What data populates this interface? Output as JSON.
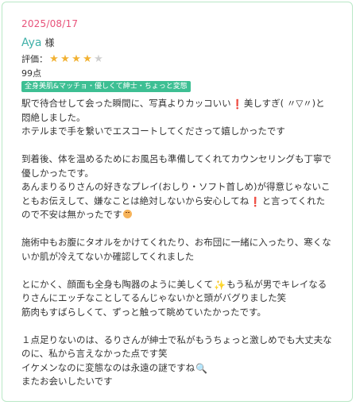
{
  "review": {
    "date": "2025/08/17",
    "reviewer_name": "Aya",
    "honorific": "様",
    "rating_label": "評価：",
    "rating": 4,
    "rating_max": 5,
    "score": "99点",
    "tag": "全身美肌&マッチョ・優しくて紳士・ちょっと変態"
  },
  "body": {
    "l01": "駅で待合せして会った瞬間に、写真よりカッコいい",
    "l01b": "美しすぎ( 〃▽〃)と",
    "l02": "悶絶しました。",
    "l03": "ホテルまで手を繋いでエスコートしてくださって嬉しかったです",
    "l04": "到着後、体を温めるためにお風呂も準備してくれてカウンセリングも丁寧で",
    "l05": "優しかったです。",
    "l06": "あんまりるりさんの好きなプレイ(おしり・ソフト首しめ)が得意じゃないこ",
    "l07": "ともお伝えして、嫌なことは絶対しないから安心してね",
    "l07b": "と言ってくれた",
    "l08": "ので不安は無かったです",
    "l09": "施術中もお腹にタオルをかけてくれたり、お布団に一緒に入ったり、寒くな",
    "l10": "いか肌が冷えてないか確認してくれました",
    "l11": "とにかく、顔面も全身も陶器のように美しくて",
    "l11b": "もう私が男でキレイなる",
    "l12": "りさんにエッチなことしてるんじゃないかと頭がバグりました笑",
    "l13": "筋肉もすばらしくて、ずっと触って眺めていたかったです。",
    "l14": "１点足りないのは、るりさんが紳士で私がもうちょっと激しめでも大丈夫な",
    "l15": "のに、私から言えなかった点です笑",
    "l16": "イケメンなのに変態なのは永遠の謎ですね",
    "l17": "またお会いしたいです"
  },
  "colors": {
    "date": "#e8527a",
    "name": "#3fb0a8",
    "star_on": "#f2b233",
    "star_off": "#cfcfcf",
    "tag_bg": "#3dbf93",
    "border": "#b9e8c6"
  },
  "icons": {
    "exclamation": "red-exclamation-icon",
    "smile": "blushing-face-icon",
    "sparkles": "sparkles-icon",
    "magnifier": "magnifying-glass-icon"
  }
}
